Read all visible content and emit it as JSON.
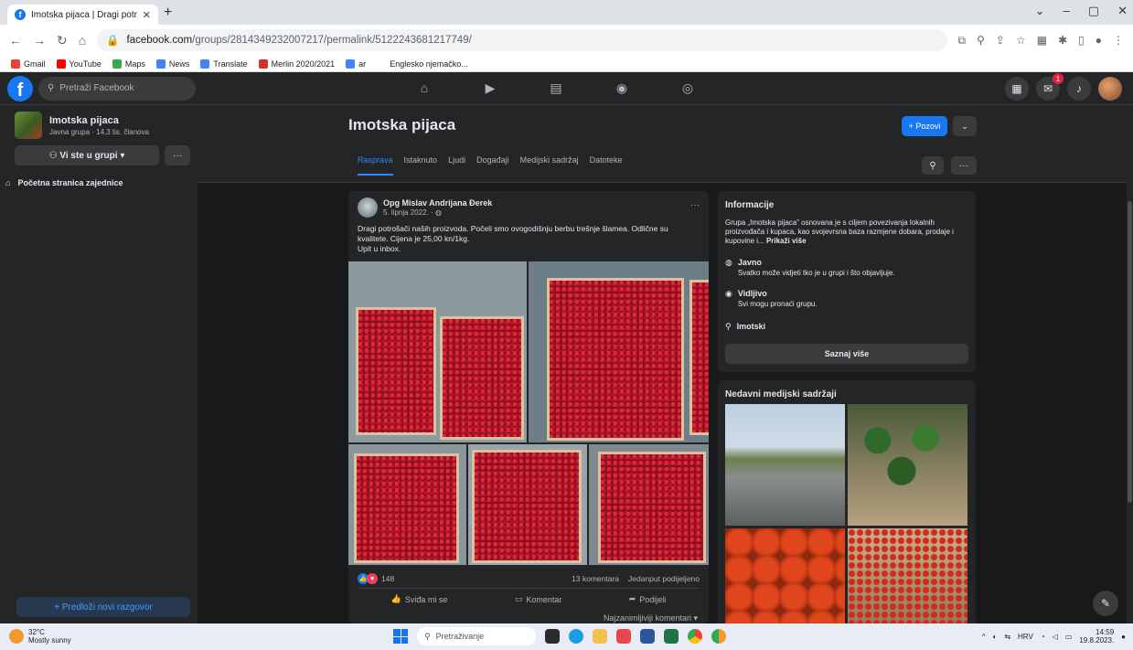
{
  "browser": {
    "tab_title": "Imotska pijaca | Dragi potrošači",
    "url_host": "facebook.com",
    "url_path": "/groups/2814349232007217/permalink/5122243681217749/",
    "bookmarks": [
      {
        "label": "Gmail",
        "color": "#ea4335"
      },
      {
        "label": "YouTube",
        "color": "#ff0000"
      },
      {
        "label": "Maps",
        "color": "#34a853"
      },
      {
        "label": "News",
        "color": "#4285f4"
      },
      {
        "label": "Translate",
        "color": "#4285f4"
      },
      {
        "label": "Merlin 2020/2021",
        "color": "#d93025"
      },
      {
        "label": "ar",
        "color": "#4285f4"
      },
      {
        "label": "Englesko njemačko...",
        "color": "#ffffff"
      }
    ]
  },
  "fb": {
    "search_placeholder": "Pretraži Facebook",
    "notif_badge": "1"
  },
  "sidebar": {
    "group_name": "Imotska pijaca",
    "group_meta": "Javna grupa · 14,3 tis. članova",
    "join_label": "Vi ste u grupi",
    "more_label": "···",
    "home_label": "Početna stranica zajednice",
    "new_post_label": "+ Predloži novi razgovor"
  },
  "group": {
    "title": "Imotska pijaca",
    "invite_label": "+ Pozovi",
    "tabs": [
      "Rasprava",
      "Istaknuto",
      "Ljudi",
      "Događaji",
      "Medijski sadržaj",
      "Datoteke"
    ]
  },
  "post": {
    "author": "Opg Mislav Andrijana Đerek",
    "date": "5. lipnja 2022. · ",
    "text_line1": "Dragi potrošači naših proizvoda. Počeli smo ovogodišnju berbu trešnje šlamea. Odlične su",
    "text_line2": "kvalitete. Cijena je 25,00 kn/1kg.",
    "text_line3": "Upit u inbox.",
    "reaction_count": "148",
    "comments": "13 komentara",
    "shares": "Jedanput podijeljeno",
    "like_label": "Sviđa mi se",
    "comment_label": "Komentar",
    "share_label": "Podijeli",
    "sort_label": "Najzanimljiviji komentari"
  },
  "info": {
    "title": "Informacije",
    "desc": "Grupa „Imotska pijaca” osnovana je s ciljem povezivanja lokalnih proizvođača i kupaca, kao svojevrsna baza razmjene dobara, prodaje i kupovine i...",
    "show_more": "Prikaži više",
    "public_title": "Javno",
    "public_desc": "Svatko može vidjeti tko je u grupi i što objavljuje.",
    "visible_title": "Vidljivo",
    "visible_desc": "Svi mogu pronaći grupu.",
    "location": "Imotski",
    "learn_more": "Saznaj više"
  },
  "media": {
    "title": "Nedavni medijski sadržaji"
  },
  "taskbar": {
    "temp": "32°C",
    "weather": "Mostly sunny",
    "search_placeholder": "Pretraživanje",
    "lang": "HRV",
    "time": "14:59",
    "date": "19.8.2023."
  }
}
